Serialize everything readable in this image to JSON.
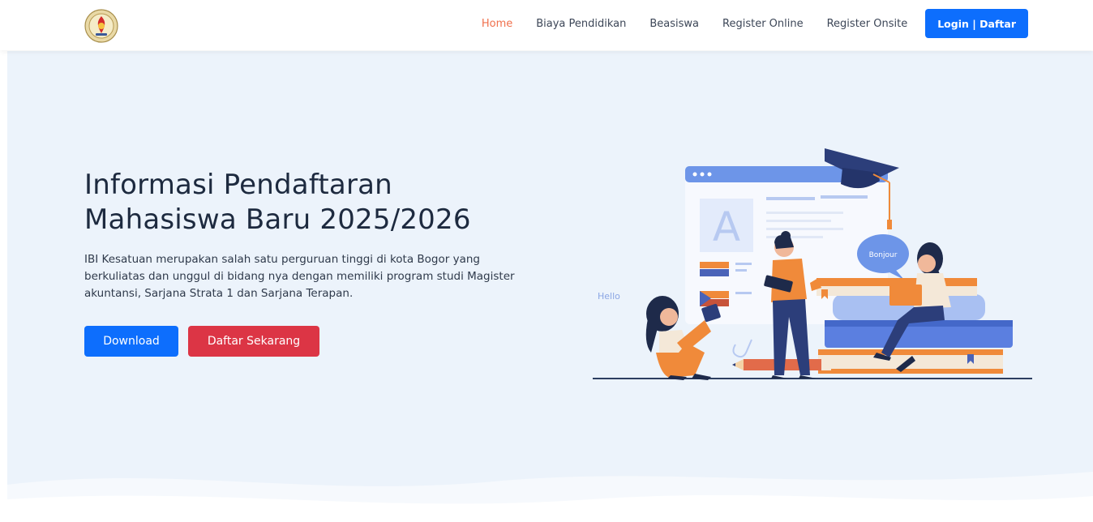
{
  "header": {
    "logo": "institution-seal-logo",
    "nav": [
      {
        "label": "Home",
        "active": true
      },
      {
        "label": "Biaya Pendidikan",
        "active": false
      },
      {
        "label": "Beasiswa",
        "active": false
      },
      {
        "label": "Register Online",
        "active": false
      },
      {
        "label": "Register Onsite",
        "active": false
      }
    ],
    "login_label": "Login | Daftar"
  },
  "hero": {
    "title_line1": "Informasi Pendaftaran",
    "title_line2": "Mahasiswa Baru 2025/2026",
    "description": "IBI Kesatuan merupakan salah satu perguruan tinggi di kota Bogor yang berkuliatas dan unggul di bidang nya dengan memiliki program studi Magister akuntansi, Sarjana Strata 1 dan Sarjana Terapan.",
    "download_label": "Download",
    "daftar_label": "Daftar Sekarang",
    "illustration": {
      "hello_text": "Hello",
      "bonjour_text": "Bonjour",
      "letter": "A"
    }
  },
  "colors": {
    "primary": "#0d6efd",
    "danger": "#dc3545",
    "active_nav": "#f0714d",
    "hero_bg": "#ecf3fb",
    "heading": "#1d2a3f"
  }
}
